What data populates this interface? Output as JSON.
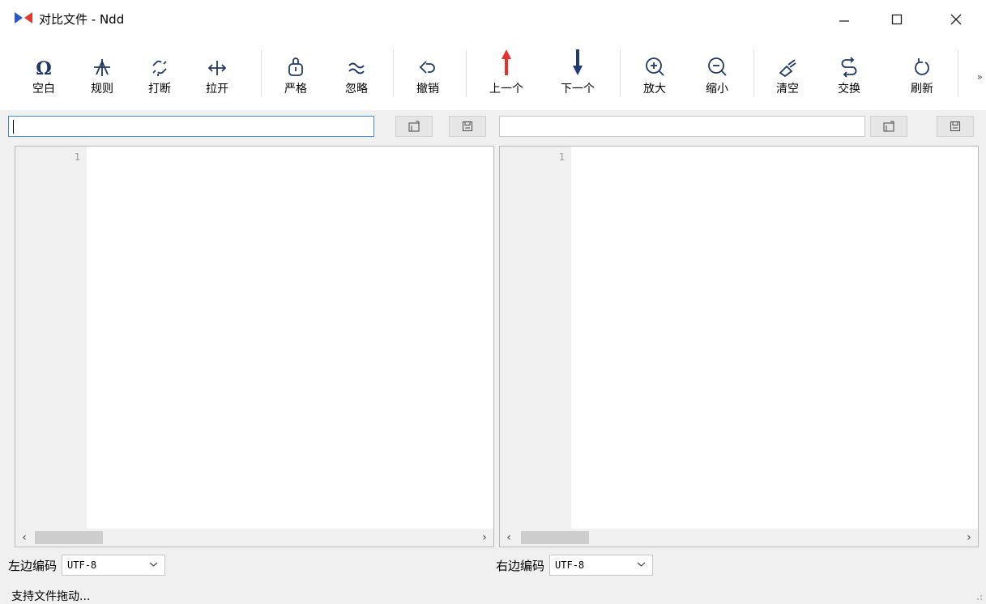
{
  "window": {
    "title": "对比文件 - Ndd",
    "minimize": "minimize",
    "maximize": "maximize",
    "close": "close"
  },
  "toolbar": {
    "buttons": [
      {
        "label": "空白",
        "icon": "omega-icon"
      },
      {
        "label": "规则",
        "icon": "rule-icon"
      },
      {
        "label": "打断",
        "icon": "break-link-icon"
      },
      {
        "label": "拉开",
        "icon": "expand-arrows-icon"
      },
      {
        "label": "严格",
        "icon": "strict-icon"
      },
      {
        "label": "忽略",
        "icon": "approx-icon"
      },
      {
        "label": "撤销",
        "icon": "undo-icon"
      },
      {
        "label": "上一个",
        "icon": "arrow-up-icon"
      },
      {
        "label": "下一个",
        "icon": "arrow-down-icon"
      },
      {
        "label": "放大",
        "icon": "zoom-in-icon"
      },
      {
        "label": "缩小",
        "icon": "zoom-out-icon"
      },
      {
        "label": "清空",
        "icon": "brush-icon"
      },
      {
        "label": "交换",
        "icon": "swap-icon"
      },
      {
        "label": "刷新",
        "icon": "refresh-icon"
      }
    ],
    "more": "»",
    "colors": {
      "up": "#e8312a",
      "down": "#1e3a6e",
      "icon": "#1f3864"
    }
  },
  "left": {
    "path_value": "",
    "line_number": "1",
    "encoding_label": "左边编码",
    "encoding_value": "UTF-8"
  },
  "right": {
    "path_value": "",
    "line_number": "1",
    "encoding_label": "右边编码",
    "encoding_value": "UTF-8"
  },
  "status": {
    "text": "支持文件拖动..."
  }
}
